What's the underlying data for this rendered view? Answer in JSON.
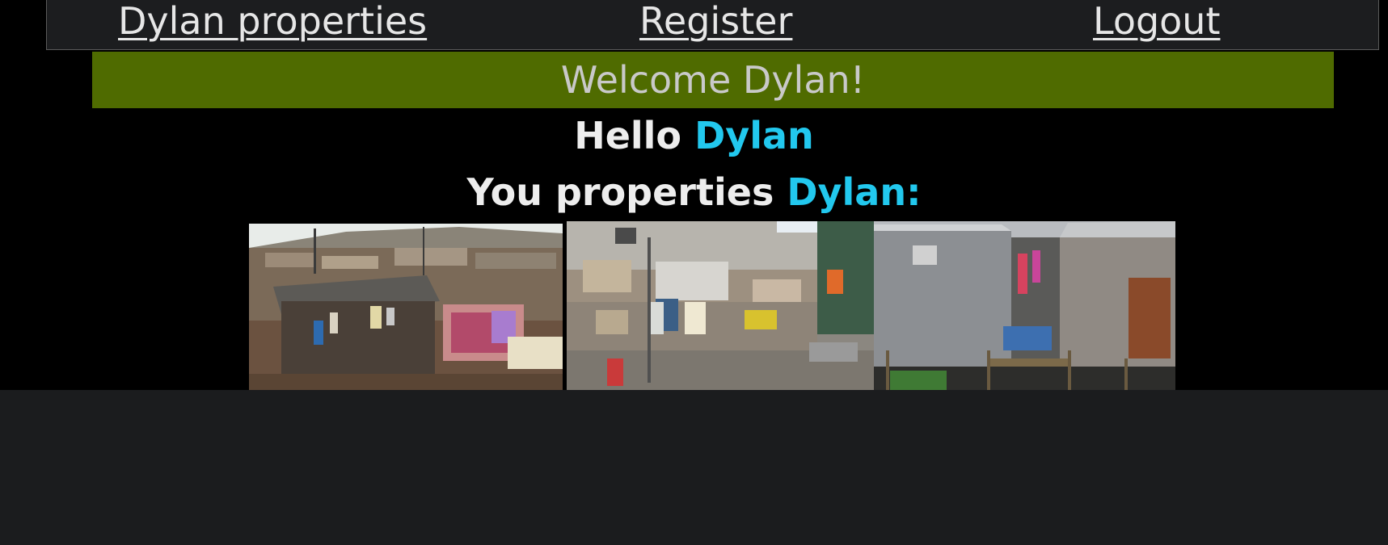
{
  "nav": {
    "brand": "Dylan properties",
    "register": "Register",
    "logout": "Logout"
  },
  "banner": {
    "text": "Welcome Dylan!"
  },
  "greeting": {
    "prefix": "Hello",
    "name": "Dylan"
  },
  "properties": {
    "prefix": "You properties",
    "name": "Dylan:"
  },
  "photos": [
    {
      "icon": "property-photo-hillside-shacks"
    },
    {
      "icon": "property-photo-stacked-shanties"
    },
    {
      "icon": "property-photo-tin-walkway"
    }
  ],
  "colors": {
    "accent": "#22c8ee",
    "banner_bg": "#4f6b00",
    "nav_bg": "#1c1d1f",
    "page_bg": "#000000"
  }
}
